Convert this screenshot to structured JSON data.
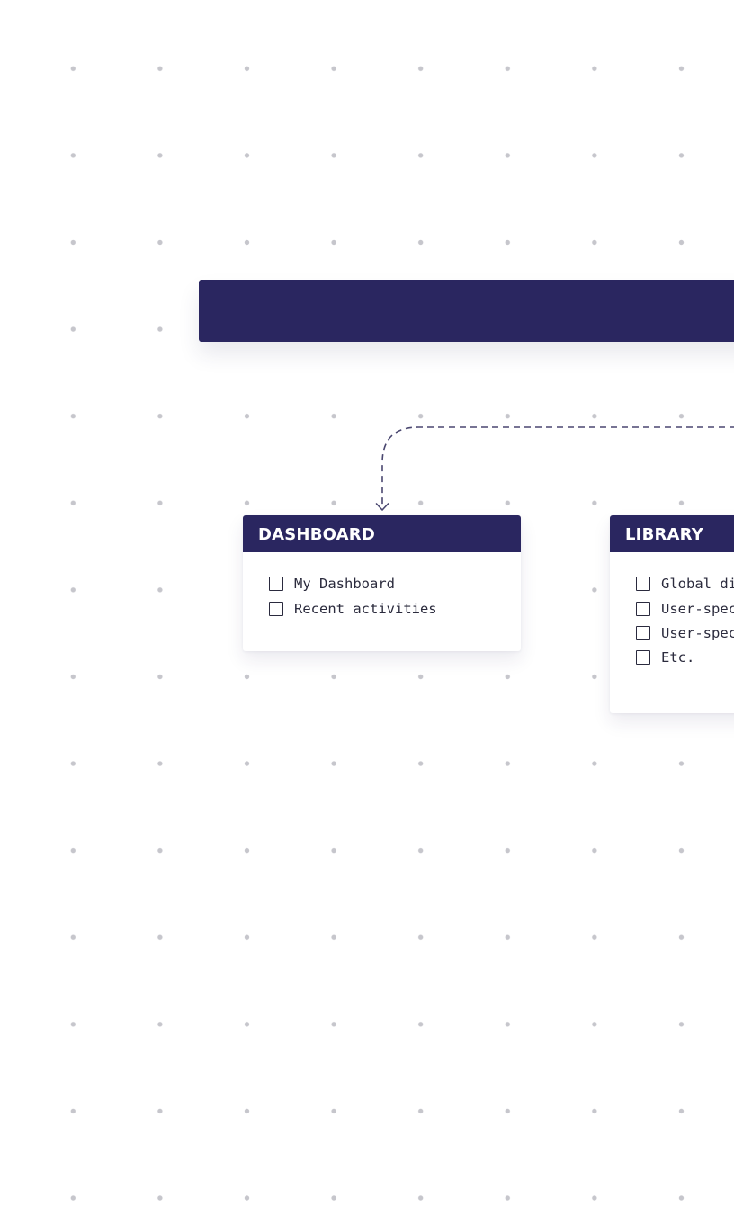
{
  "colors": {
    "primary": "#2a2660",
    "connector": "#4a4770",
    "dot": "#c6c6cc",
    "background": "#ffffff",
    "text": "#2b2b3d"
  },
  "cards": {
    "dashboard": {
      "title": "DASHBOARD",
      "items": [
        "My Dashboard",
        "Recent activities"
      ]
    },
    "library": {
      "title": "LIBRARY",
      "items": [
        "Global di",
        "User-spec",
        "User-spec",
        "Etc."
      ]
    }
  }
}
